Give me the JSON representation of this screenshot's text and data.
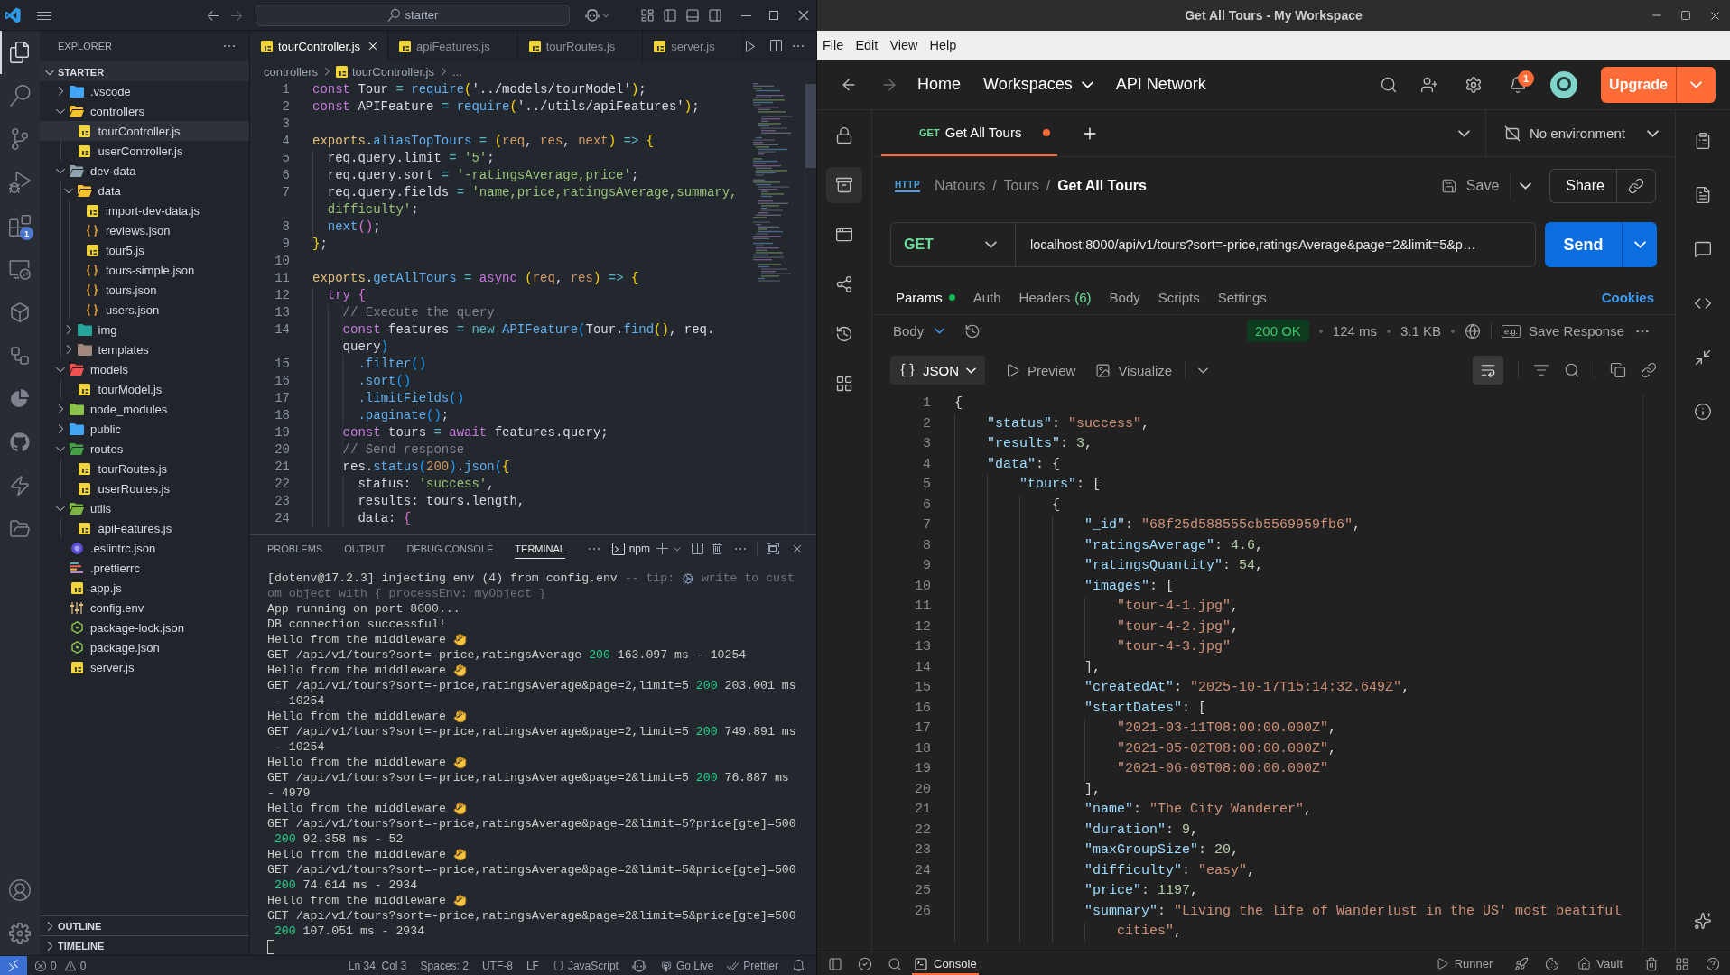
{
  "vscode": {
    "search": "starter",
    "activity_bar": [
      {
        "kind": "explorer",
        "selected": true
      },
      {
        "kind": "search",
        "selected": false
      },
      {
        "kind": "source-control",
        "selected": false
      },
      {
        "kind": "run",
        "selected": false
      },
      {
        "kind": "extensions",
        "selected": false,
        "badge": "1"
      },
      {
        "kind": "remote",
        "selected": false
      },
      {
        "kind": "containers",
        "selected": false
      },
      {
        "kind": "workflow",
        "selected": false
      },
      {
        "kind": "pie",
        "selected": false
      },
      {
        "kind": "github",
        "selected": false
      },
      {
        "kind": "lightning",
        "selected": false
      },
      {
        "kind": "folders",
        "selected": false
      }
    ],
    "explorer": {
      "title": "EXPLORER",
      "root": "STARTER",
      "root_expanded": true,
      "tree": [
        {
          "label": ".vscode",
          "kind": "folder",
          "color": "#42a5f5",
          "expanded": false,
          "selected": false
        },
        {
          "label": "controllers",
          "kind": "folder",
          "color": "#f9c22e",
          "expanded": true,
          "selected": false,
          "children": [
            {
              "label": "tourController.js",
              "kind": "js",
              "selected": true
            },
            {
              "label": "userController.js",
              "kind": "js",
              "selected": false
            }
          ]
        },
        {
          "label": "dev-data",
          "kind": "folder",
          "color": "#90a4ae",
          "expanded": true,
          "selected": false,
          "children": [
            {
              "label": "data",
              "kind": "folder",
              "color": "#f9c22e",
              "expanded": true,
              "selected": false,
              "children": [
                {
                  "label": "import-dev-data.js",
                  "kind": "js",
                  "selected": false
                },
                {
                  "label": "reviews.json",
                  "kind": "json",
                  "selected": false
                },
                {
                  "label": "tour5.js",
                  "kind": "js",
                  "selected": false
                },
                {
                  "label": "tours-simple.json",
                  "kind": "json",
                  "selected": false
                },
                {
                  "label": "tours.json",
                  "kind": "json",
                  "selected": false
                },
                {
                  "label": "users.json",
                  "kind": "json",
                  "selected": false
                }
              ]
            },
            {
              "label": "img",
              "kind": "folder",
              "color": "#26a69a",
              "expanded": false,
              "selected": false
            },
            {
              "label": "templates",
              "kind": "folder",
              "color": "#a1887f",
              "expanded": false,
              "selected": false
            }
          ]
        },
        {
          "label": "models",
          "kind": "folder",
          "color": "#ef5350",
          "expanded": true,
          "selected": false,
          "children": [
            {
              "label": "tourModel.js",
              "kind": "js",
              "selected": false
            }
          ]
        },
        {
          "label": "node_modules",
          "kind": "folder",
          "color": "#8bc34a",
          "expanded": false,
          "selected": false
        },
        {
          "label": "public",
          "kind": "folder",
          "color": "#42a5f5",
          "expanded": false,
          "selected": false
        },
        {
          "label": "routes",
          "kind": "folder",
          "color": "#43a047",
          "expanded": true,
          "selected": false,
          "children": [
            {
              "label": "tourRoutes.js",
              "kind": "js",
              "selected": false
            },
            {
              "label": "userRoutes.js",
              "kind": "js",
              "selected": false
            }
          ]
        },
        {
          "label": "utils",
          "kind": "folder",
          "color": "#7cb342",
          "expanded": true,
          "selected": false,
          "children": [
            {
              "label": "apiFeatures.js",
              "kind": "js",
              "selected": false
            }
          ]
        },
        {
          "label": ".eslintrc.json",
          "kind": "eslint",
          "selected": false
        },
        {
          "label": ".prettierrc",
          "kind": "prettier",
          "selected": false
        },
        {
          "label": "app.js",
          "kind": "js",
          "selected": false
        },
        {
          "label": "config.env",
          "kind": "env",
          "selected": false
        },
        {
          "label": "package-lock.json",
          "kind": "npm",
          "selected": false
        },
        {
          "label": "package.json",
          "kind": "npm",
          "selected": false
        },
        {
          "label": "server.js",
          "kind": "js",
          "selected": false
        }
      ],
      "sections": [
        {
          "label": "OUTLINE",
          "expanded": false
        },
        {
          "label": "TIMELINE",
          "expanded": false
        }
      ]
    },
    "editor": {
      "tabs": [
        {
          "label": "tourController.js",
          "selected": true
        },
        {
          "label": "apiFeatures.js",
          "selected": false
        },
        {
          "label": "tourRoutes.js",
          "selected": false
        },
        {
          "label": "server.js",
          "selected": false
        }
      ],
      "breadcrumb": [
        {
          "label": "controllers",
          "kind": "folder"
        },
        {
          "label": "tourController.js",
          "kind": "js"
        },
        {
          "label": "...",
          "kind": "symbol"
        }
      ],
      "lines": [
        {
          "number": "1",
          "tokens": [
            {
              "text": "const",
              "kind": "keyword"
            },
            {
              "text": " Tour ",
              "kind": "plain"
            },
            {
              "text": "= ",
              "kind": "operator"
            },
            {
              "text": "require",
              "kind": "function"
            },
            {
              "text": "(",
              "kind": "bracket1"
            },
            {
              "text": "'../models/tourModel'",
              "kind": "plain"
            },
            {
              "text": ")",
              "kind": "bracket1"
            },
            {
              "text": ";",
              "kind": "plain"
            }
          ]
        },
        {
          "number": "2",
          "tokens": [
            {
              "text": "const",
              "kind": "keyword"
            },
            {
              "text": " APIFeature ",
              "kind": "plain"
            },
            {
              "text": "= ",
              "kind": "operator"
            },
            {
              "text": "require",
              "kind": "function"
            },
            {
              "text": "(",
              "kind": "bracket1"
            },
            {
              "text": "'../utils/apiFeatures'",
              "kind": "plain"
            },
            {
              "text": ")",
              "kind": "bracket1"
            },
            {
              "text": ";",
              "kind": "plain"
            }
          ]
        },
        {
          "number": "3"
        },
        {
          "number": "4",
          "tokens": [
            {
              "text": "exports",
              "kind": "object"
            },
            {
              "text": ".",
              "kind": "plain"
            },
            {
              "text": "aliasTopTours",
              "kind": "function"
            },
            {
              "text": " = ",
              "kind": "operator"
            },
            {
              "text": "(",
              "kind": "bracket1"
            },
            {
              "text": "req",
              "kind": "parameter"
            },
            {
              "text": ", ",
              "kind": "plain"
            },
            {
              "text": "res",
              "kind": "parameter"
            },
            {
              "text": ", ",
              "kind": "plain"
            },
            {
              "text": "next",
              "kind": "parameter"
            },
            {
              "text": ")",
              "kind": "bracket1"
            },
            {
              "text": " => ",
              "kind": "operator"
            },
            {
              "text": "{",
              "kind": "bracket1"
            }
          ]
        },
        {
          "number": "5",
          "tokens": [
            {
              "text": "  req.query.limit ",
              "kind": "plain"
            },
            {
              "text": "= ",
              "kind": "operator"
            },
            {
              "text": "'5'",
              "kind": "string"
            },
            {
              "text": ";",
              "kind": "plain"
            }
          ]
        },
        {
          "number": "6",
          "tokens": [
            {
              "text": "  req.query.sort ",
              "kind": "plain"
            },
            {
              "text": "= ",
              "kind": "operator"
            },
            {
              "text": "'-ratingsAverage,price'",
              "kind": "string"
            },
            {
              "text": ";",
              "kind": "plain"
            }
          ]
        },
        {
          "number": "7",
          "tokens": [
            {
              "text": "  req.query.fields ",
              "kind": "plain"
            },
            {
              "text": "= ",
              "kind": "operator"
            },
            {
              "text": "'name,price,ratingsAverage,summary,",
              "kind": "string"
            }
          ]
        },
        {
          "tokens": [
            {
              "text": "  difficulty'",
              "kind": "string"
            },
            {
              "text": ";",
              "kind": "plain"
            }
          ]
        },
        {
          "number": "8",
          "tokens": [
            {
              "text": "  next",
              "kind": "function"
            },
            {
              "text": "()",
              "kind": "bracket2"
            },
            {
              "text": ";",
              "kind": "plain"
            }
          ]
        },
        {
          "number": "9",
          "tokens": [
            {
              "text": "}",
              "kind": "bracket1"
            },
            {
              "text": ";",
              "kind": "plain"
            }
          ]
        },
        {
          "number": "10"
        },
        {
          "number": "11",
          "tokens": [
            {
              "text": "exports",
              "kind": "object"
            },
            {
              "text": ".",
              "kind": "plain"
            },
            {
              "text": "getAllTours",
              "kind": "function"
            },
            {
              "text": " = ",
              "kind": "operator"
            },
            {
              "text": "async ",
              "kind": "keyword"
            },
            {
              "text": "(",
              "kind": "bracket1"
            },
            {
              "text": "req",
              "kind": "parameter"
            },
            {
              "text": ", ",
              "kind": "plain"
            },
            {
              "text": "res",
              "kind": "parameter"
            },
            {
              "text": ")",
              "kind": "bracket1"
            },
            {
              "text": " => ",
              "kind": "operator"
            },
            {
              "text": "{",
              "kind": "bracket1"
            }
          ]
        },
        {
          "number": "12",
          "tokens": [
            {
              "text": "  try ",
              "kind": "keyword"
            },
            {
              "text": "{",
              "kind": "bracket2"
            }
          ]
        },
        {
          "number": "13",
          "tokens": [
            {
              "text": "    // Execute the query",
              "kind": "comment"
            }
          ]
        },
        {
          "number": "14",
          "tokens": [
            {
              "text": "    const",
              "kind": "keyword"
            },
            {
              "text": " features ",
              "kind": "plain"
            },
            {
              "text": "= new ",
              "kind": "operator"
            },
            {
              "text": "APIFeature",
              "kind": "function"
            },
            {
              "text": "(",
              "kind": "bracket3"
            },
            {
              "text": "Tour.",
              "kind": "plain"
            },
            {
              "text": "find",
              "kind": "function"
            },
            {
              "text": "()",
              "kind": "bracket1"
            },
            {
              "text": ", req.",
              "kind": "plain"
            }
          ]
        },
        {
          "tokens": [
            {
              "text": "    query",
              "kind": "plain"
            },
            {
              "text": ")",
              "kind": "bracket3"
            }
          ]
        },
        {
          "number": "15",
          "tokens": [
            {
              "text": "      .filter",
              "kind": "function"
            },
            {
              "text": "()",
              "kind": "bracket3"
            }
          ]
        },
        {
          "number": "16",
          "tokens": [
            {
              "text": "      .sort",
              "kind": "function"
            },
            {
              "text": "()",
              "kind": "bracket3"
            }
          ]
        },
        {
          "number": "17",
          "tokens": [
            {
              "text": "      .limitFields",
              "kind": "function"
            },
            {
              "text": "()",
              "kind": "bracket3"
            }
          ]
        },
        {
          "number": "18",
          "tokens": [
            {
              "text": "      .paginate",
              "kind": "function"
            },
            {
              "text": "()",
              "kind": "bracket3"
            },
            {
              "text": ";",
              "kind": "plain"
            }
          ]
        },
        {
          "number": "19",
          "tokens": [
            {
              "text": "    const",
              "kind": "keyword"
            },
            {
              "text": " tours ",
              "kind": "plain"
            },
            {
              "text": "= ",
              "kind": "operator"
            },
            {
              "text": "await",
              "kind": "keyword"
            },
            {
              "text": " features.query;",
              "kind": "plain"
            }
          ]
        },
        {
          "number": "20",
          "tokens": [
            {
              "text": "    // Send response",
              "kind": "comment"
            }
          ]
        },
        {
          "number": "21",
          "tokens": [
            {
              "text": "    res.",
              "kind": "plain"
            },
            {
              "text": "status",
              "kind": "function"
            },
            {
              "text": "(",
              "kind": "bracket3"
            },
            {
              "text": "200",
              "kind": "number"
            },
            {
              "text": ")",
              "kind": "bracket3"
            },
            {
              "text": ".",
              "kind": "plain"
            },
            {
              "text": "json",
              "kind": "function"
            },
            {
              "text": "(",
              "kind": "bracket3"
            },
            {
              "text": "{",
              "kind": "bracket1"
            }
          ]
        },
        {
          "number": "22",
          "tokens": [
            {
              "text": "      status: ",
              "kind": "plain"
            },
            {
              "text": "'success'",
              "kind": "string"
            },
            {
              "text": ",",
              "kind": "plain"
            }
          ]
        },
        {
          "number": "23",
          "tokens": [
            {
              "text": "      results: tours.length,",
              "kind": "plain"
            }
          ]
        },
        {
          "number": "24",
          "tokens": [
            {
              "text": "      data: ",
              "kind": "plain"
            },
            {
              "text": "{",
              "kind": "bracket2"
            }
          ]
        }
      ]
    },
    "panel": {
      "tabs": [
        {
          "label": "PROBLEMS",
          "selected": false
        },
        {
          "label": "OUTPUT",
          "selected": false
        },
        {
          "label": "DEBUG CONSOLE",
          "selected": false
        },
        {
          "label": "TERMINAL",
          "selected": true
        }
      ],
      "terminal": "npm",
      "lines": [
        [
          {
            "text": "[dotenv@17.2.3] injecting env (4) from config.env ",
            "kind": "plain"
          },
          {
            "text": "-- tip: ",
            "kind": "dim"
          },
          {
            "kind": "gear"
          },
          {
            "text": " write to cust",
            "kind": "dim"
          }
        ],
        [
          {
            "text": "om object with { processEnv: myObject }",
            "kind": "dim"
          }
        ],
        [
          {
            "text": "App running on port 8000...",
            "kind": "plain"
          }
        ],
        [
          {
            "text": "DB connection successful!",
            "kind": "plain"
          }
        ],
        [
          {
            "text": "Hello from the middleware ",
            "kind": "plain"
          },
          {
            "kind": "wave"
          }
        ],
        [
          {
            "text": "GET /api/v1/tours?sort=-price,ratingsAverage ",
            "kind": "plain"
          },
          {
            "text": "200",
            "kind": "success"
          },
          {
            "text": " 163.097 ms - 10254",
            "kind": "plain"
          }
        ],
        [
          {
            "text": "Hello from the middleware ",
            "kind": "plain"
          },
          {
            "kind": "wave"
          }
        ],
        [
          {
            "text": "GET /api/v1/tours?sort=-price,ratingsAverage&page=2,limit=5 ",
            "kind": "plain"
          },
          {
            "text": "200",
            "kind": "success"
          },
          {
            "text": " 203.001 ms",
            "kind": "plain"
          }
        ],
        [
          {
            "text": " - 10254",
            "kind": "plain"
          }
        ],
        [
          {
            "text": "Hello from the middleware ",
            "kind": "plain"
          },
          {
            "kind": "wave"
          }
        ],
        [
          {
            "text": "GET /api/v1/tours?sort=-price,ratingsAverage&page=2,limit=5 ",
            "kind": "plain"
          },
          {
            "text": "200",
            "kind": "success"
          },
          {
            "text": " 749.891 ms",
            "kind": "plain"
          }
        ],
        [
          {
            "text": " - 10254",
            "kind": "plain"
          }
        ],
        [
          {
            "text": "Hello from the middleware ",
            "kind": "plain"
          },
          {
            "kind": "wave"
          }
        ],
        [
          {
            "text": "GET /api/v1/tours?sort=-price,ratingsAverage&page=2&limit=5 ",
            "kind": "plain"
          },
          {
            "text": "200",
            "kind": "success"
          },
          {
            "text": " 76.887 ms",
            "kind": "plain"
          }
        ],
        [
          {
            "text": "- 4979",
            "kind": "plain"
          }
        ],
        [
          {
            "text": "Hello from the middleware ",
            "kind": "plain"
          },
          {
            "kind": "wave"
          }
        ],
        [
          {
            "text": "GET /api/v1/tours?sort=-price,ratingsAverage&page=2&limit=5?price[gte]=500",
            "kind": "plain"
          }
        ],
        [
          {
            "text": " 200",
            "kind": "success"
          },
          {
            "text": " 92.358 ms - 52",
            "kind": "plain"
          }
        ],
        [
          {
            "text": "Hello from the middleware ",
            "kind": "plain"
          },
          {
            "kind": "wave"
          }
        ],
        [
          {
            "text": "GET /api/v1/tours?sort=-price,ratingsAverage&page=2&limit=5&price[gte]=500",
            "kind": "plain"
          }
        ],
        [
          {
            "text": " 200",
            "kind": "success"
          },
          {
            "text": " 74.614 ms - 2934",
            "kind": "plain"
          }
        ],
        [
          {
            "text": "Hello from the middleware ",
            "kind": "plain"
          },
          {
            "kind": "wave"
          }
        ],
        [
          {
            "text": "GET /api/v1/tours?sort=-price,ratingsAverage&page=2&limit=5&price[gte]=500",
            "kind": "plain"
          }
        ],
        [
          {
            "text": " 200",
            "kind": "success"
          },
          {
            "text": " 107.051 ms - 2934",
            "kind": "plain"
          }
        ]
      ]
    },
    "status_bar": {
      "errors": "0",
      "warnings": "0",
      "position": "Ln 34, Col 3",
      "indentation": "Spaces: 2",
      "encoding": "UTF-8",
      "eol": "LF",
      "language": "JavaScript",
      "live_server": "Go Live",
      "formatter": "Prettier"
    }
  },
  "postman": {
    "title": "Get All Tours - My Workspace",
    "menu": [
      "File",
      "Edit",
      "View",
      "Help"
    ],
    "nav": [
      {
        "label": "Home",
        "dropdown": false
      },
      {
        "label": "Workspaces",
        "dropdown": true
      },
      {
        "label": "API Network",
        "dropdown": false
      }
    ],
    "notifications": "1",
    "upgrade": "Upgrade",
    "sidebar": [
      {
        "kind": "lock",
        "selected": false
      },
      {
        "kind": "collections",
        "selected": true
      },
      {
        "kind": "environments",
        "selected": false
      },
      {
        "kind": "flows",
        "selected": false
      },
      {
        "kind": "history",
        "selected": false
      },
      {
        "kind": "add-ons",
        "selected": false
      }
    ],
    "tabs": [
      {
        "method": "GET",
        "label": "Get All Tours",
        "unsaved": true,
        "selected": true
      }
    ],
    "environment": "No environment",
    "request": {
      "protocol": "HTTP",
      "breadcrumb": [
        {
          "label": "Natours"
        },
        {
          "label": "Tours",
          "separator": "/"
        },
        {
          "label": "Get All Tours",
          "separator": "/"
        }
      ],
      "save": "Save",
      "share": "Share",
      "method": "GET",
      "url": "localhost:8000/api/v1/tours?sort=-price,ratingsAverage&page=2&limit=5&p…",
      "send": "Send"
    },
    "request_tabs": [
      {
        "label": "Params",
        "indicator": true,
        "selected": true
      },
      {
        "label": "Auth",
        "indicator": false,
        "selected": false
      },
      {
        "label": "Headers",
        "count": "(6)",
        "indicator": false,
        "selected": false
      },
      {
        "label": "Body",
        "indicator": false,
        "selected": false
      },
      {
        "label": "Scripts",
        "indicator": false,
        "selected": false
      },
      {
        "label": "Settings",
        "indicator": false,
        "selected": false
      }
    ],
    "cookies": "Cookies",
    "response": {
      "section": "Body",
      "status": "200 OK",
      "time": "124 ms",
      "size": "3.1 KB",
      "example_badge": "e.g.",
      "save_response": "Save Response",
      "format": "JSON",
      "views": [
        {
          "label": "Preview",
          "kind": "preview"
        },
        {
          "label": "Visualize",
          "kind": "visualize"
        }
      ],
      "wrap_lines": true,
      "lines": [
        {
          "number": "1",
          "tokens": [
            {
              "text": "{",
              "kind": "punct"
            }
          ]
        },
        {
          "number": "2",
          "tokens": [
            {
              "text": "    \"status\"",
              "kind": "key"
            },
            {
              "text": ": ",
              "kind": "punct"
            },
            {
              "text": "\"success\"",
              "kind": "string"
            },
            {
              "text": ",",
              "kind": "punct"
            }
          ]
        },
        {
          "number": "3",
          "tokens": [
            {
              "text": "    \"results\"",
              "kind": "key"
            },
            {
              "text": ": ",
              "kind": "punct"
            },
            {
              "text": "3",
              "kind": "number"
            },
            {
              "text": ",",
              "kind": "punct"
            }
          ]
        },
        {
          "number": "4",
          "tokens": [
            {
              "text": "    \"data\"",
              "kind": "key"
            },
            {
              "text": ": {",
              "kind": "punct"
            }
          ]
        },
        {
          "number": "5",
          "tokens": [
            {
              "text": "        \"tours\"",
              "kind": "key"
            },
            {
              "text": ": [",
              "kind": "punct"
            }
          ]
        },
        {
          "number": "6",
          "tokens": [
            {
              "text": "            {",
              "kind": "punct"
            }
          ]
        },
        {
          "number": "7",
          "tokens": [
            {
              "text": "                \"_id\"",
              "kind": "key"
            },
            {
              "text": ": ",
              "kind": "punct"
            },
            {
              "text": "\"68f25d588555cb5569959fb6\"",
              "kind": "string"
            },
            {
              "text": ",",
              "kind": "punct"
            }
          ]
        },
        {
          "number": "8",
          "tokens": [
            {
              "text": "                \"ratingsAverage\"",
              "kind": "key"
            },
            {
              "text": ": ",
              "kind": "punct"
            },
            {
              "text": "4.6",
              "kind": "number"
            },
            {
              "text": ",",
              "kind": "punct"
            }
          ]
        },
        {
          "number": "9",
          "tokens": [
            {
              "text": "                \"ratingsQuantity\"",
              "kind": "key"
            },
            {
              "text": ": ",
              "kind": "punct"
            },
            {
              "text": "54",
              "kind": "number"
            },
            {
              "text": ",",
              "kind": "punct"
            }
          ]
        },
        {
          "number": "10",
          "tokens": [
            {
              "text": "                \"images\"",
              "kind": "key"
            },
            {
              "text": ": [",
              "kind": "punct"
            }
          ]
        },
        {
          "number": "11",
          "tokens": [
            {
              "text": "                    \"tour-4-1.jpg\"",
              "kind": "string"
            },
            {
              "text": ",",
              "kind": "punct"
            }
          ]
        },
        {
          "number": "12",
          "tokens": [
            {
              "text": "                    \"tour-4-2.jpg\"",
              "kind": "string"
            },
            {
              "text": ",",
              "kind": "punct"
            }
          ]
        },
        {
          "number": "13",
          "tokens": [
            {
              "text": "                    \"tour-4-3.jpg\"",
              "kind": "string"
            }
          ]
        },
        {
          "number": "14",
          "tokens": [
            {
              "text": "                ],",
              "kind": "punct"
            }
          ]
        },
        {
          "number": "15",
          "tokens": [
            {
              "text": "                \"createdAt\"",
              "kind": "key"
            },
            {
              "text": ": ",
              "kind": "punct"
            },
            {
              "text": "\"2025-10-17T15:14:32.649Z\"",
              "kind": "string"
            },
            {
              "text": ",",
              "kind": "punct"
            }
          ]
        },
        {
          "number": "16",
          "tokens": [
            {
              "text": "                \"startDates\"",
              "kind": "key"
            },
            {
              "text": ": [",
              "kind": "punct"
            }
          ]
        },
        {
          "number": "17",
          "tokens": [
            {
              "text": "                    \"2021-03-11T08:00:00.000Z\"",
              "kind": "string"
            },
            {
              "text": ",",
              "kind": "punct"
            }
          ]
        },
        {
          "number": "18",
          "tokens": [
            {
              "text": "                    \"2021-05-02T08:00:00.000Z\"",
              "kind": "string"
            },
            {
              "text": ",",
              "kind": "punct"
            }
          ]
        },
        {
          "number": "19",
          "tokens": [
            {
              "text": "                    \"2021-06-09T08:00:00.000Z\"",
              "kind": "string"
            }
          ]
        },
        {
          "number": "20",
          "tokens": [
            {
              "text": "                ],",
              "kind": "punct"
            }
          ]
        },
        {
          "number": "21",
          "tokens": [
            {
              "text": "                \"name\"",
              "kind": "key"
            },
            {
              "text": ": ",
              "kind": "punct"
            },
            {
              "text": "\"The City Wanderer\"",
              "kind": "string"
            },
            {
              "text": ",",
              "kind": "punct"
            }
          ]
        },
        {
          "number": "22",
          "tokens": [
            {
              "text": "                \"duration\"",
              "kind": "key"
            },
            {
              "text": ": ",
              "kind": "punct"
            },
            {
              "text": "9",
              "kind": "number"
            },
            {
              "text": ",",
              "kind": "punct"
            }
          ]
        },
        {
          "number": "23",
          "tokens": [
            {
              "text": "                \"maxGroupSize\"",
              "kind": "key"
            },
            {
              "text": ": ",
              "kind": "punct"
            },
            {
              "text": "20",
              "kind": "number"
            },
            {
              "text": ",",
              "kind": "punct"
            }
          ]
        },
        {
          "number": "24",
          "tokens": [
            {
              "text": "                \"difficulty\"",
              "kind": "key"
            },
            {
              "text": ": ",
              "kind": "punct"
            },
            {
              "text": "\"easy\"",
              "kind": "string"
            },
            {
              "text": ",",
              "kind": "punct"
            }
          ]
        },
        {
          "number": "25",
          "tokens": [
            {
              "text": "                \"price\"",
              "kind": "key"
            },
            {
              "text": ": ",
              "kind": "punct"
            },
            {
              "text": "1197",
              "kind": "number"
            },
            {
              "text": ",",
              "kind": "punct"
            }
          ]
        },
        {
          "number": "26",
          "tokens": [
            {
              "text": "                \"summary\"",
              "kind": "key"
            },
            {
              "text": ": ",
              "kind": "punct"
            },
            {
              "text": "\"Living the life of Wanderlust in the US' most beatiful",
              "kind": "string"
            }
          ]
        },
        {
          "tokens": [
            {
              "text": "                    cities\"",
              "kind": "string"
            },
            {
              "text": ",",
              "kind": "punct"
            }
          ]
        }
      ]
    },
    "status_bar": {
      "console": "Console",
      "console_selected": true,
      "runner": "Runner",
      "vault": "Vault"
    }
  }
}
